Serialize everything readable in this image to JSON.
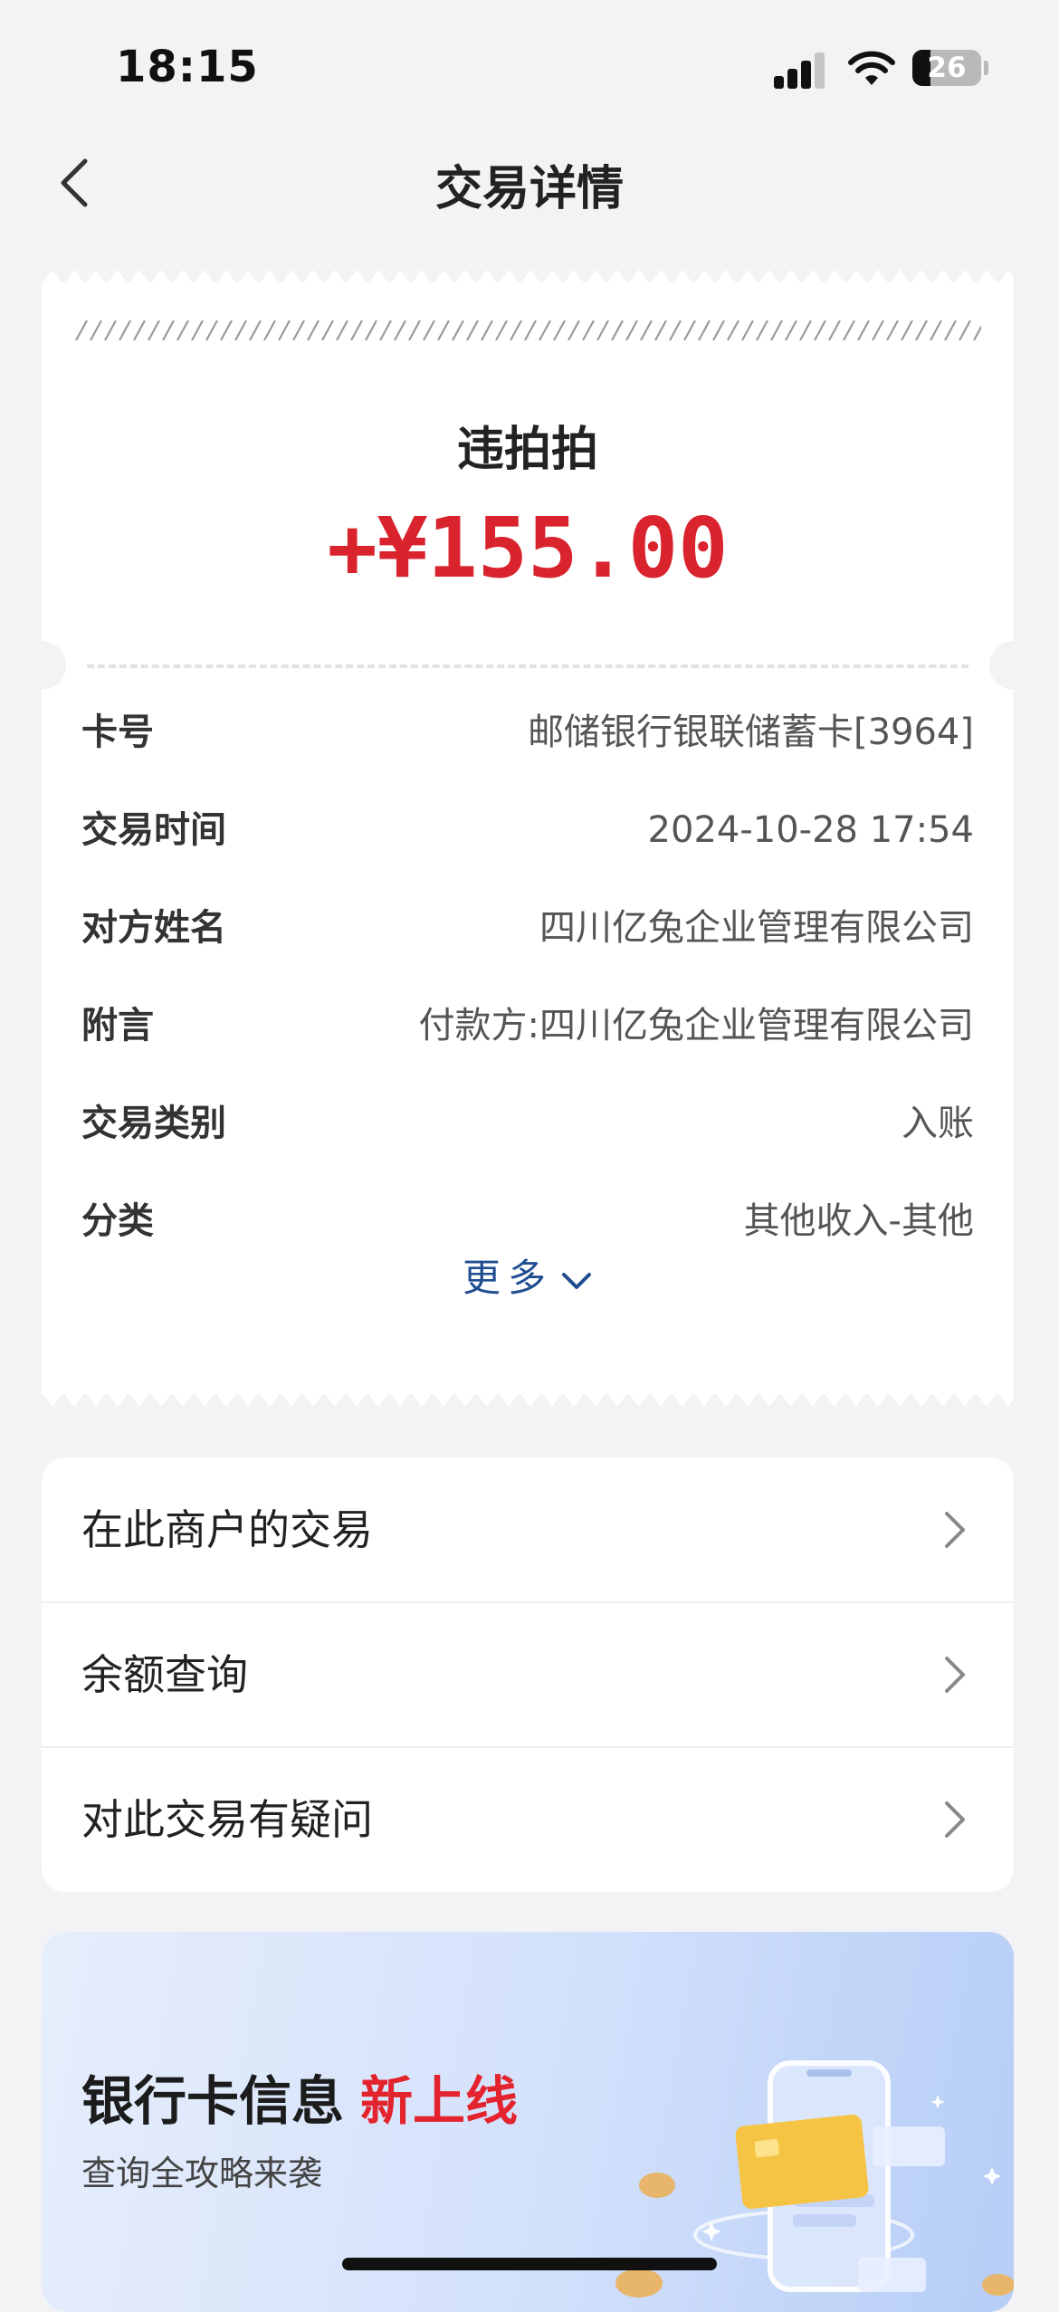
{
  "status_bar": {
    "time": "18:15",
    "battery": "26"
  },
  "nav": {
    "title": "交易详情"
  },
  "transaction": {
    "merchant": "违拍拍",
    "amount": "+¥155.00",
    "details": [
      {
        "label": "卡号",
        "value": "邮储银行银联储蓄卡[3964]"
      },
      {
        "label": "交易时间",
        "value": "2024-10-28 17:54"
      },
      {
        "label": "对方姓名",
        "value": "四川亿兔企业管理有限公司"
      },
      {
        "label": "附言",
        "value": "付款方:四川亿兔企业管理有限公司"
      },
      {
        "label": "交易类别",
        "value": "入账"
      },
      {
        "label": "分类",
        "value": "其他收入-其他"
      }
    ],
    "more_label": "更多"
  },
  "menu": [
    {
      "label": "在此商户的交易"
    },
    {
      "label": "余额查询"
    },
    {
      "label": "对此交易有疑问"
    }
  ],
  "banner": {
    "title": "银行卡信息",
    "highlight": "新上线",
    "subtitle": "查询全攻略来袭"
  },
  "colors": {
    "amount_red": "#d9232d",
    "link_blue": "#1f4d8f",
    "background": "#f3f3f5"
  }
}
